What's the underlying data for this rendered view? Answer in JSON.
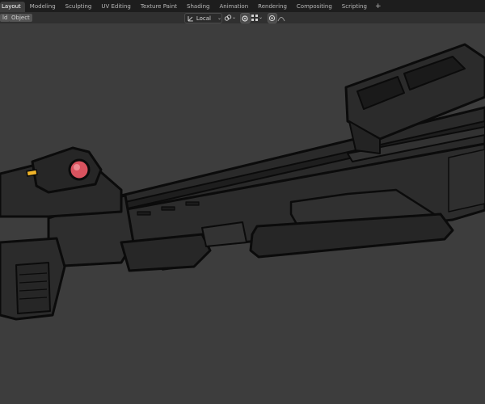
{
  "workspace_tabs": [
    {
      "label": "Layout",
      "active": true
    },
    {
      "label": "Modeling"
    },
    {
      "label": "Sculpting"
    },
    {
      "label": "UV Editing"
    },
    {
      "label": "Texture Paint"
    },
    {
      "label": "Shading"
    },
    {
      "label": "Animation"
    },
    {
      "label": "Rendering"
    },
    {
      "label": "Compositing"
    },
    {
      "label": "Scripting"
    }
  ],
  "add_workspace": "+",
  "viewport_header": {
    "menu_left": "ld",
    "menu_object": "Object",
    "transform_orientation": "Local"
  },
  "colors": {
    "background": "#3d3d3d",
    "scope_lens": "#d9535f",
    "accent_yellow": "#f0b429"
  }
}
